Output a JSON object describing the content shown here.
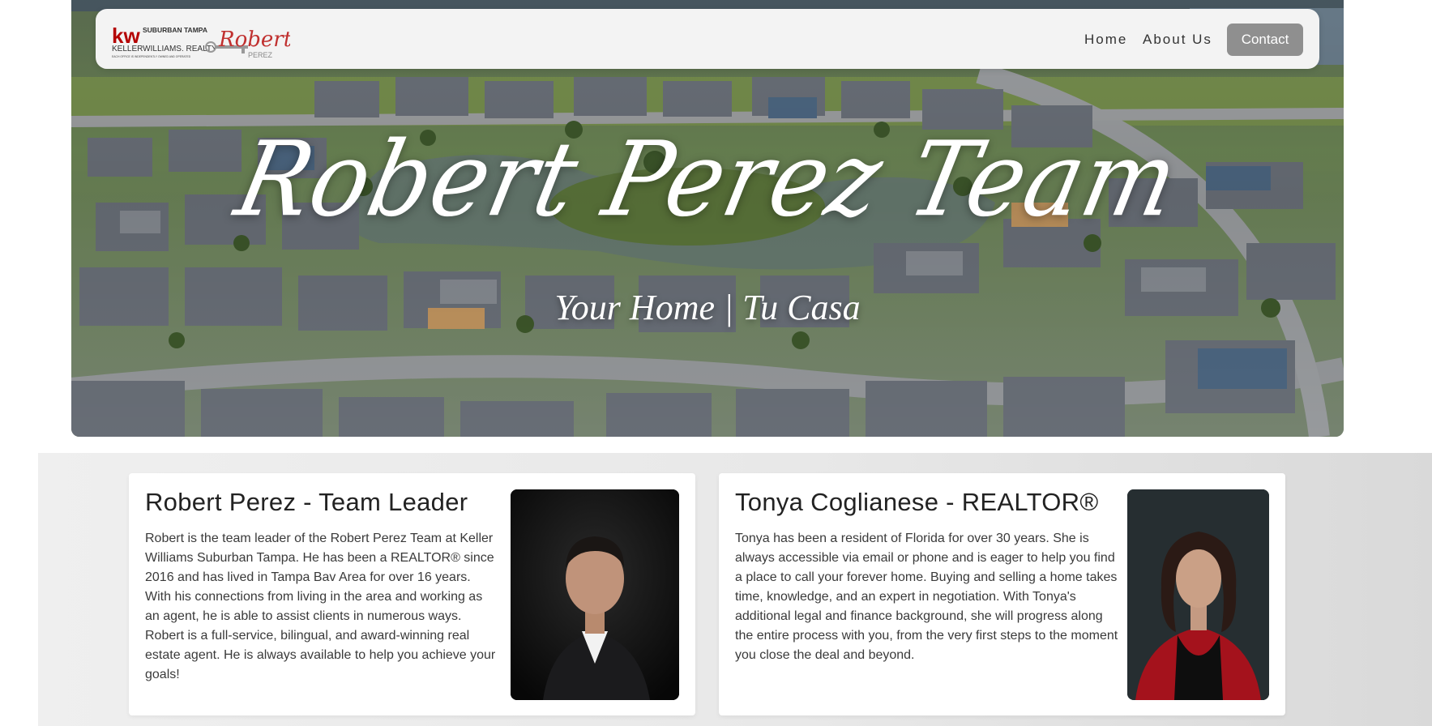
{
  "nav": {
    "logo": {
      "brand_initials": "kw",
      "office": "SUBURBAN TAMPA",
      "company": "KELLERWILLIAMS. REALTY",
      "tagline": "EACH OFFICE IS INDEPENDENTLY OWNED AND OPERATED",
      "agent_first": "Robert",
      "agent_last": "PEREZ"
    },
    "links": [
      {
        "label": "Home"
      },
      {
        "label": "About Us"
      }
    ],
    "contact_label": "Contact"
  },
  "hero": {
    "title": "Robert Perez Team",
    "subtitle": "Your Home | Tu Casa"
  },
  "team": [
    {
      "name": "Robert Perez - Team Leader",
      "bio": "Robert is the team leader of the Robert Perez Team at Keller Williams Suburban Tampa. He has been a REALTOR® since 2016 and has lived in Tampa Bav Area for over 16 years. With his connections from living in the area and working as an agent, he is able to assist clients in numerous ways. Robert is a full-service, bilingual, and award-winning real estate agent. He is always available to help you achieve your goals!"
    },
    {
      "name": "Tonya Coglianese - REALTOR®",
      "bio": "Tonya has been a resident of Florida for over 30 years. She is always accessible via email or phone and is eager to help you find a place to call your forever home. Buying and selling a home takes time, knowledge, and an expert in negotiation. With Tonya's additional legal and finance background, she will progress along the entire process with you, from the very first steps to the moment you close the deal and beyond."
    }
  ],
  "colors": {
    "kw_red": "#b40101",
    "contact_button": "#8f8f8f",
    "navbar_bg": "#f3f3f3"
  }
}
